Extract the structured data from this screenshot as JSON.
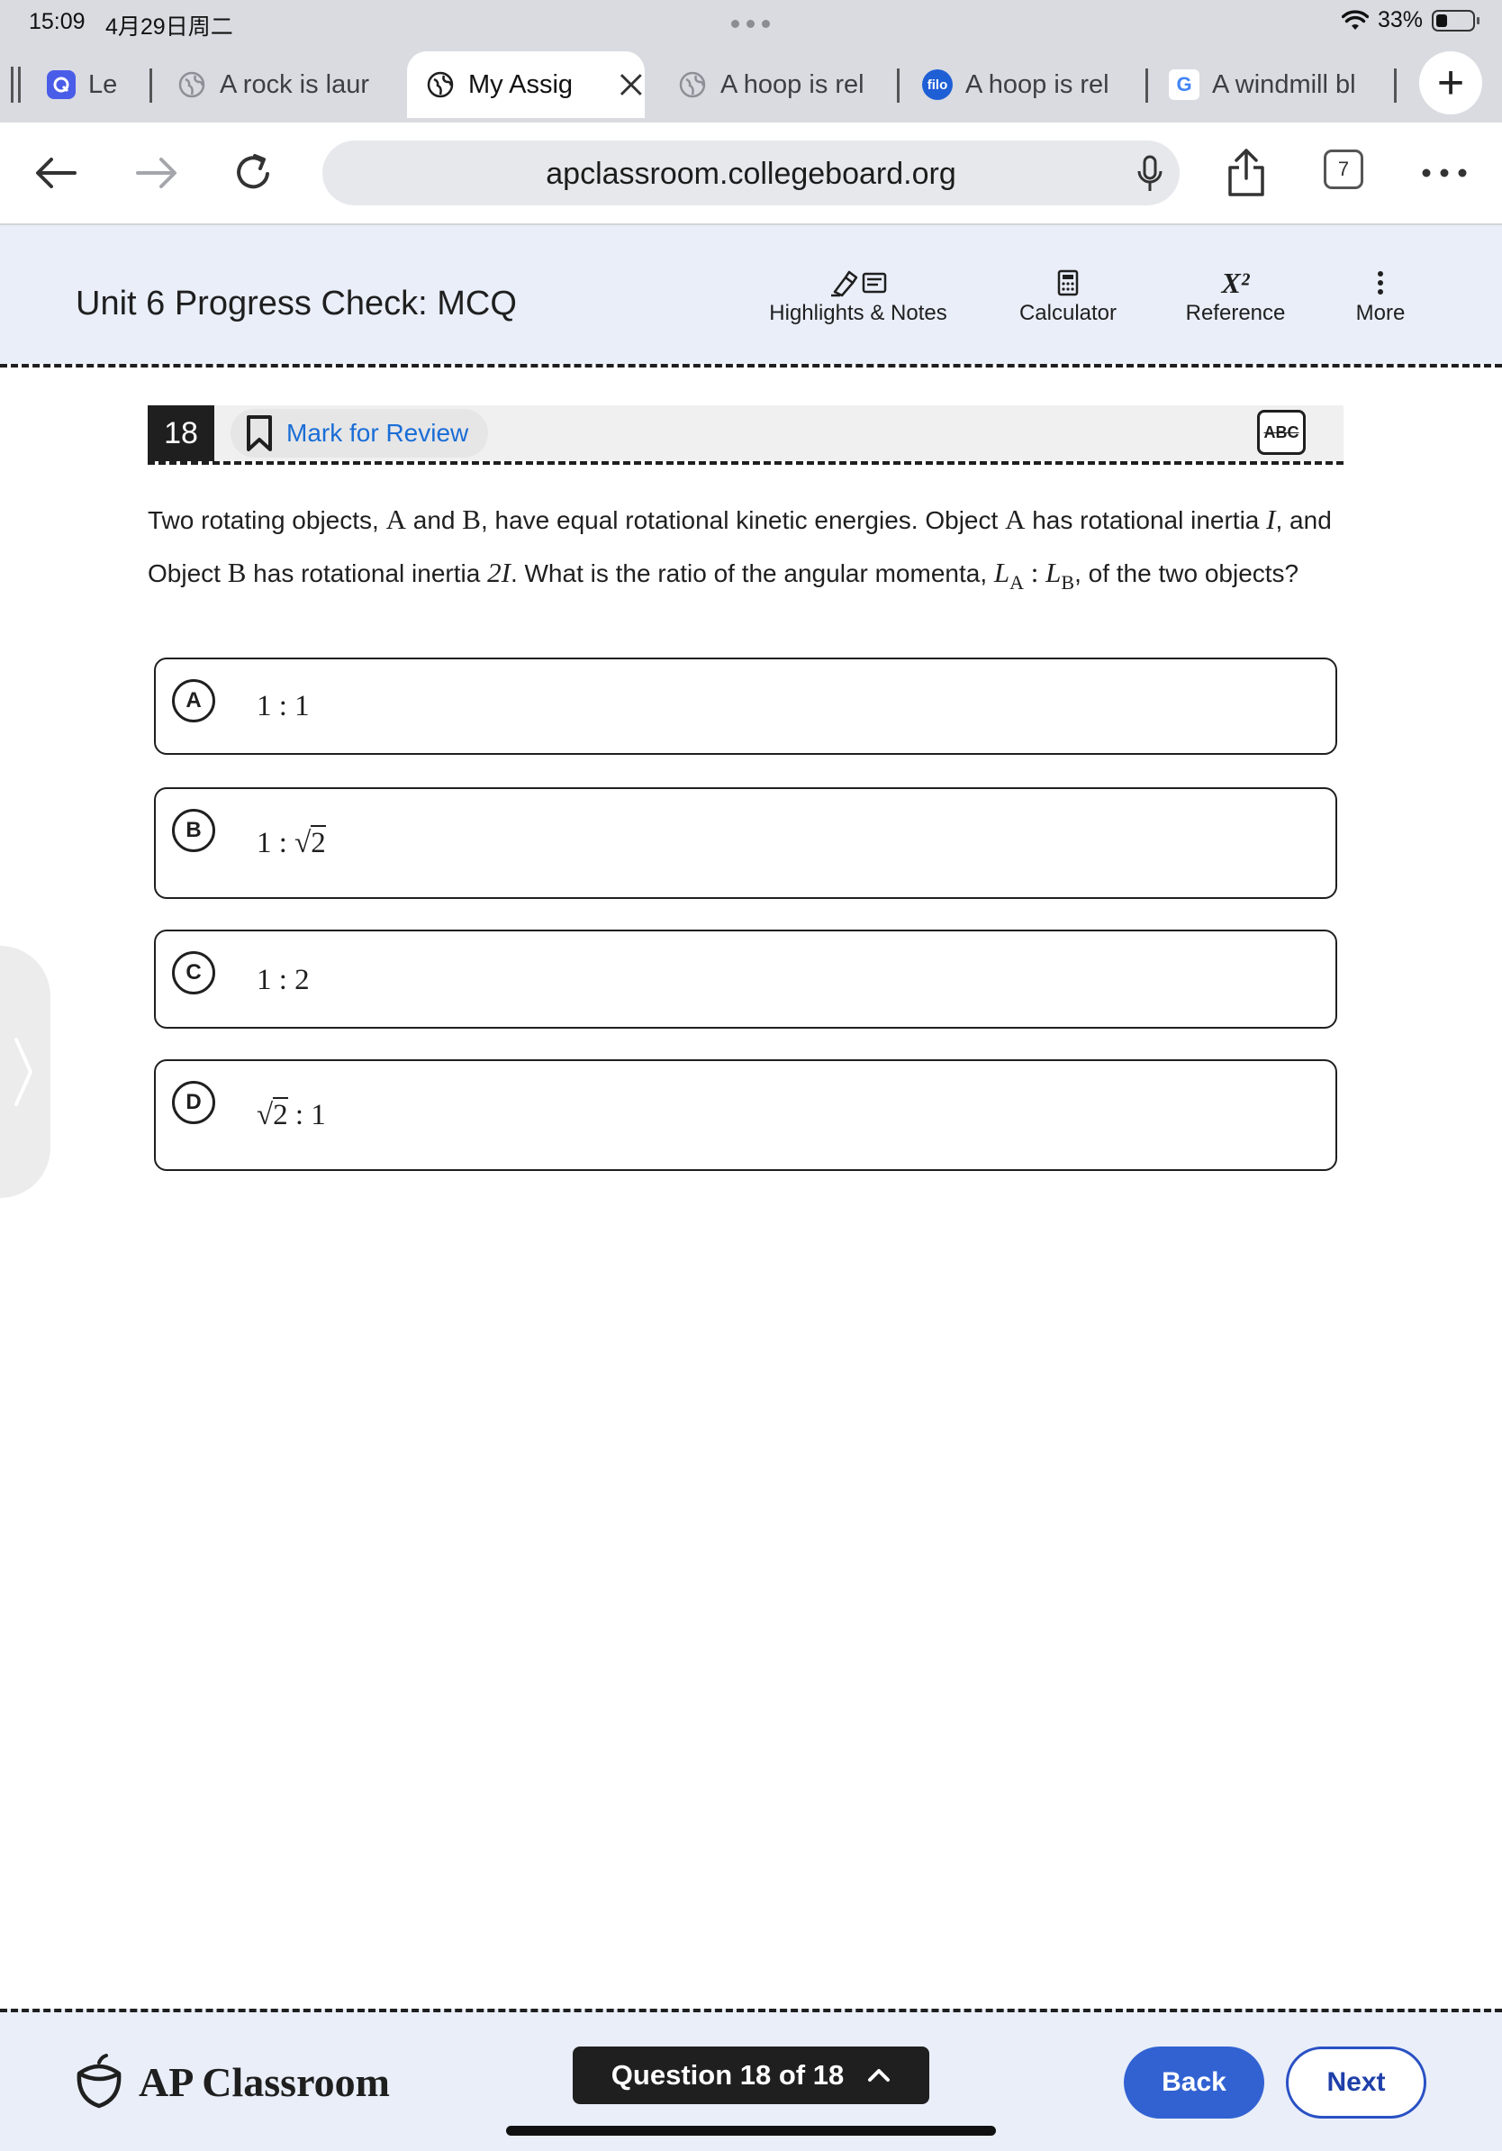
{
  "status": {
    "time": "15:09",
    "date": "4月29日周二",
    "battery": "33%",
    "battery_level": 0.33
  },
  "browser": {
    "tabs": [
      {
        "title": "Le",
        "icon": "q-app-icon"
      },
      {
        "title": "A rock is laur",
        "icon": "globe-icon"
      },
      {
        "title": "My Assig",
        "icon": "globe-icon",
        "active": true
      },
      {
        "title": "A hoop is rel",
        "icon": "globe-icon"
      },
      {
        "title": "A hoop is rel",
        "icon": "filo-icon",
        "favicon_text": "filo"
      },
      {
        "title": "A windmill bl",
        "icon": "google-icon",
        "favicon_text": "G"
      }
    ],
    "url": "apclassroom.collegeboard.org",
    "tab_count": "7"
  },
  "header": {
    "title": "Unit 6 Progress Check: MCQ",
    "tools": {
      "highlights": "Highlights & Notes",
      "calculator": "Calculator",
      "reference": "Reference",
      "more": "More"
    },
    "reference_glyph": "X²"
  },
  "question": {
    "number": "18",
    "mark_for_review": "Mark for Review",
    "abc_label": "ABC",
    "stem": {
      "s1": "Two rotating objects, ",
      "A1": "A",
      "s2": " and ",
      "B1": "B",
      "s3": ", have equal rotational kinetic energies. Object ",
      "A2": "A",
      "s4": " has rotational inertia ",
      "I1": "I",
      "s5": ", and",
      "s6": "Object ",
      "B2": "B",
      "s7": " has rotational inertia ",
      "I2": "2I",
      "s8": ". What is the ratio of the angular momenta, ",
      "L": "L",
      "subA": "A",
      "colon": " : ",
      "subB": "B",
      "s9": ", of the two objects?"
    },
    "choices": [
      {
        "letter": "A",
        "text": "1 : 1"
      },
      {
        "letter": "B",
        "pre": "1 : ",
        "root": "2",
        "post": ""
      },
      {
        "letter": "C",
        "text": "1 : 2"
      },
      {
        "letter": "D",
        "pre": "",
        "root": "2",
        "post": " : 1"
      }
    ]
  },
  "footer": {
    "brand": "AP Classroom",
    "question_nav": "Question 18 of 18",
    "back": "Back",
    "next": "Next"
  },
  "colors": {
    "accent_blue": "#3262d2",
    "link_blue": "#1a6dd6",
    "header_bg": "#e9eef8"
  }
}
